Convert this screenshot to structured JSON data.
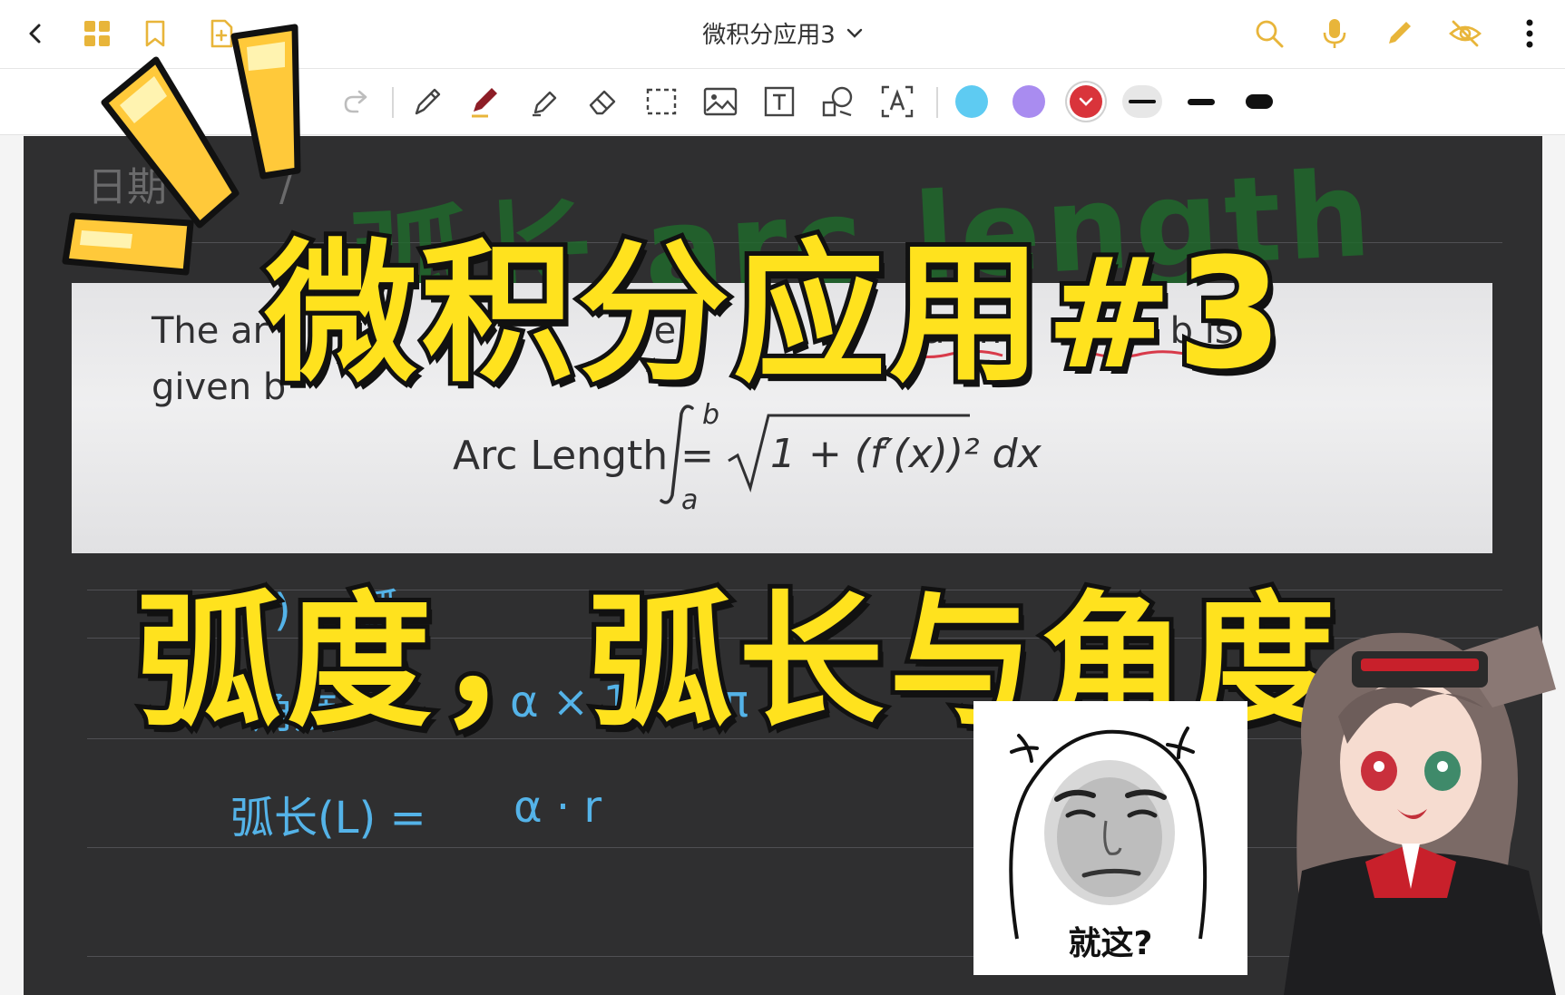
{
  "top_bar": {
    "document_title": "微积分应用3",
    "icons": {
      "back": "chevron-left-icon",
      "grid": "grid-icon",
      "bookmark": "bookmark-icon",
      "add_page": "add-page-icon",
      "search": "search-icon",
      "mic": "microphone-icon",
      "pen": "pen-icon",
      "hide": "eye-off-icon",
      "more": "more-vertical-icon"
    },
    "accent_color": "#e8b53a"
  },
  "toolbar": {
    "tools": [
      "redo-icon",
      "pencil-icon",
      "pen-icon",
      "highlighter-icon",
      "eraser-icon",
      "lasso-select-icon",
      "image-icon",
      "text-box-icon",
      "shape-icon",
      "ocr-text-icon"
    ],
    "colors": [
      "#5ecbf2",
      "#a98cf0",
      "#d9343b"
    ],
    "active_color": "#d9343b",
    "strokes": [
      "thin",
      "medium",
      "thick"
    ],
    "active_stroke": "thin"
  },
  "note": {
    "date_label": "日期",
    "date_sep": "/",
    "heading_handwritten": "弧长 arc length",
    "screenshot": {
      "line1_start": "The ar",
      "line1_mid": "ve",
      "line1_end_a": "a and",
      "line1_end_b": "x = b is",
      "line2": "given b",
      "formula_label": "Arc Length =",
      "formula_upper": "b",
      "formula_lower": "a",
      "formula_body": "1 + (f′(x))²  dx"
    },
    "handwritten_lines": [
      {
        "left": ")  = 弧",
        "right": ""
      },
      {
        "left": "角度   =",
        "right": "α × 180°/π"
      },
      {
        "left": "弧长(L) =",
        "right": "α · r"
      }
    ]
  },
  "overlay": {
    "title_line1": "微积分应用#3",
    "title_line2": "弧度，弧长与角度",
    "title_color": "#ffe21e",
    "burst_color": "#ffc93a"
  },
  "meme": {
    "caption": "就这?"
  }
}
